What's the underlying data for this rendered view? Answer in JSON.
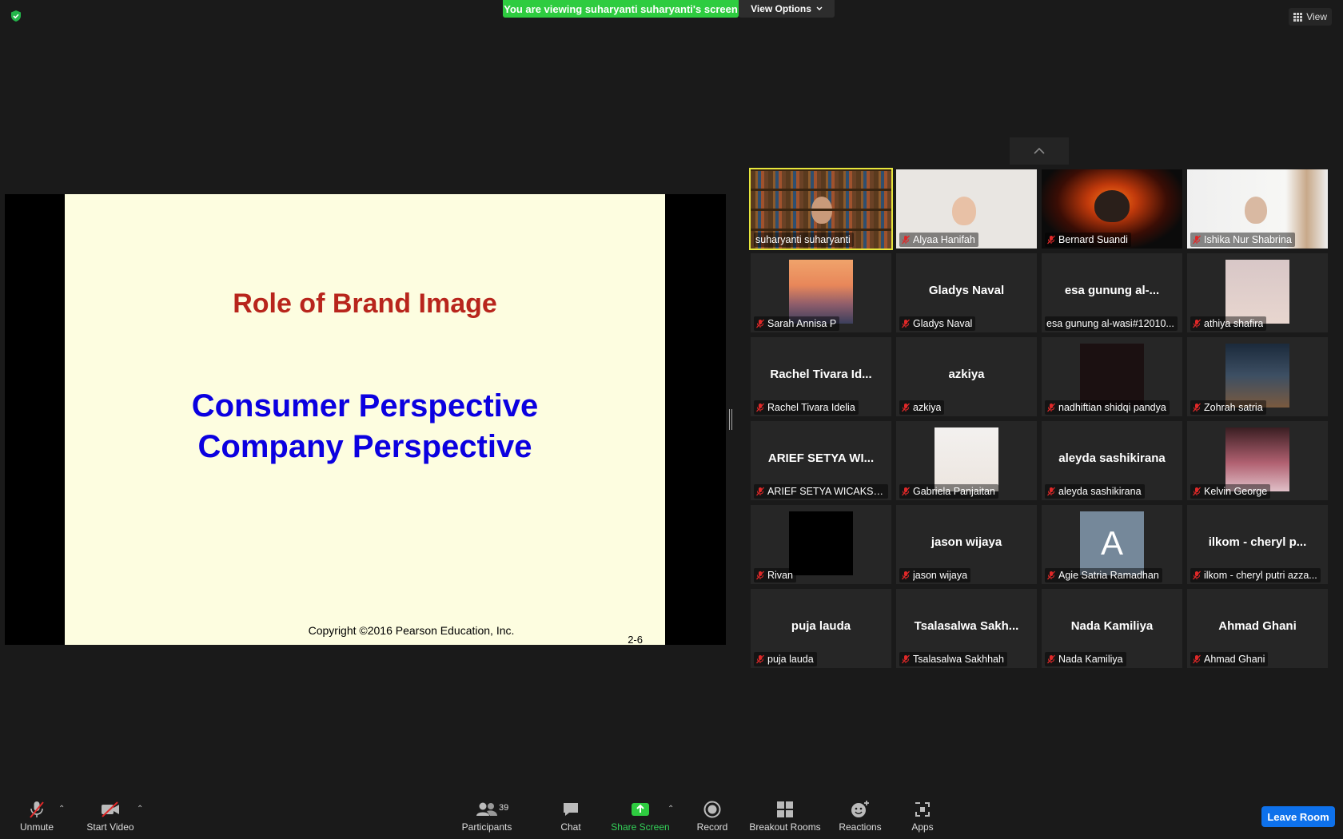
{
  "top": {
    "banner": "You are viewing suharyanti suharyanti's screen",
    "view_options": "View Options",
    "view": "View"
  },
  "slide": {
    "title": "Role of Brand Image",
    "line1": "Consumer Perspective",
    "line2": "Company Perspective",
    "copyright": "Copyright ©2016 Pearson Education, Inc.",
    "page": "2-6"
  },
  "participants": [
    {
      "name": "suharyanti suharyanti",
      "big": "",
      "muted": false,
      "video": "books",
      "speaking": true
    },
    {
      "name": "Alyaa Hanifah",
      "big": "",
      "muted": true,
      "video": "light"
    },
    {
      "name": "Bernard Suandi",
      "big": "",
      "muted": true,
      "video": "fire"
    },
    {
      "name": "Ishika Nur Shabrina",
      "big": "",
      "muted": true,
      "video": "room"
    },
    {
      "name": "Sarah Annisa P",
      "big": "",
      "muted": true,
      "video": "bridge"
    },
    {
      "name": "Gladys Naval",
      "big": "Gladys Naval",
      "muted": true,
      "video": "none"
    },
    {
      "name": "esa gunung al-wasi#12010...",
      "big": "esa gunung al-...",
      "muted": false,
      "video": "none"
    },
    {
      "name": "athiya shafira",
      "big": "",
      "muted": true,
      "video": "pink"
    },
    {
      "name": "Rachel Tivara Idelia",
      "big": "Rachel Tivara Id...",
      "muted": true,
      "video": "none"
    },
    {
      "name": "azkiya",
      "big": "azkiya",
      "muted": true,
      "video": "none"
    },
    {
      "name": "nadhiftian shidqi pandya",
      "big": "",
      "muted": true,
      "video": "blank-dark"
    },
    {
      "name": "Zohrah satria",
      "big": "",
      "muted": true,
      "video": "moto"
    },
    {
      "name": "ARIEF SETYA WICAKSANA",
      "big": "ARIEF SETYA WI...",
      "muted": true,
      "video": "none"
    },
    {
      "name": "Gabriela Panjaitan",
      "big": "",
      "muted": true,
      "video": "portrait"
    },
    {
      "name": "aleyda sashikirana",
      "big": "aleyda sashikirana",
      "muted": true,
      "video": "none"
    },
    {
      "name": "Kelvin George",
      "big": "",
      "muted": true,
      "video": "anime"
    },
    {
      "name": "Rivan",
      "big": "",
      "muted": true,
      "video": "blank-black"
    },
    {
      "name": "jason wijaya",
      "big": "jason wijaya",
      "muted": true,
      "video": "none"
    },
    {
      "name": "Agie Satria Ramadhan",
      "big": "",
      "muted": true,
      "video": "avatar",
      "avatar_letter": "A"
    },
    {
      "name": "ilkom - cheryl putri azza...",
      "big": "ilkom - cheryl p...",
      "muted": true,
      "video": "none"
    },
    {
      "name": "puja lauda",
      "big": "puja lauda",
      "muted": true,
      "video": "none"
    },
    {
      "name": "Tsalasalwa Sakhhah",
      "big": "Tsalasalwa  Sakh...",
      "muted": true,
      "video": "none"
    },
    {
      "name": "Nada Kamiliya",
      "big": "Nada Kamiliya",
      "muted": true,
      "video": "none"
    },
    {
      "name": "Ahmad Ghani",
      "big": "Ahmad Ghani",
      "muted": true,
      "video": "none"
    }
  ],
  "toolbar": {
    "unmute": "Unmute",
    "start_video": "Start Video",
    "participants": "Participants",
    "participants_count": "39",
    "chat": "Chat",
    "share_screen": "Share Screen",
    "record": "Record",
    "breakout_rooms": "Breakout Rooms",
    "reactions": "Reactions",
    "apps": "Apps",
    "leave": "Leave Room"
  },
  "colors": {
    "banner_green": "#2ecc40",
    "slide_title": "#b8251c",
    "slide_body": "#0b00e0",
    "speaker_outline": "#e6e63c",
    "leave_blue": "#0e71eb",
    "mute_red": "#e02828"
  }
}
